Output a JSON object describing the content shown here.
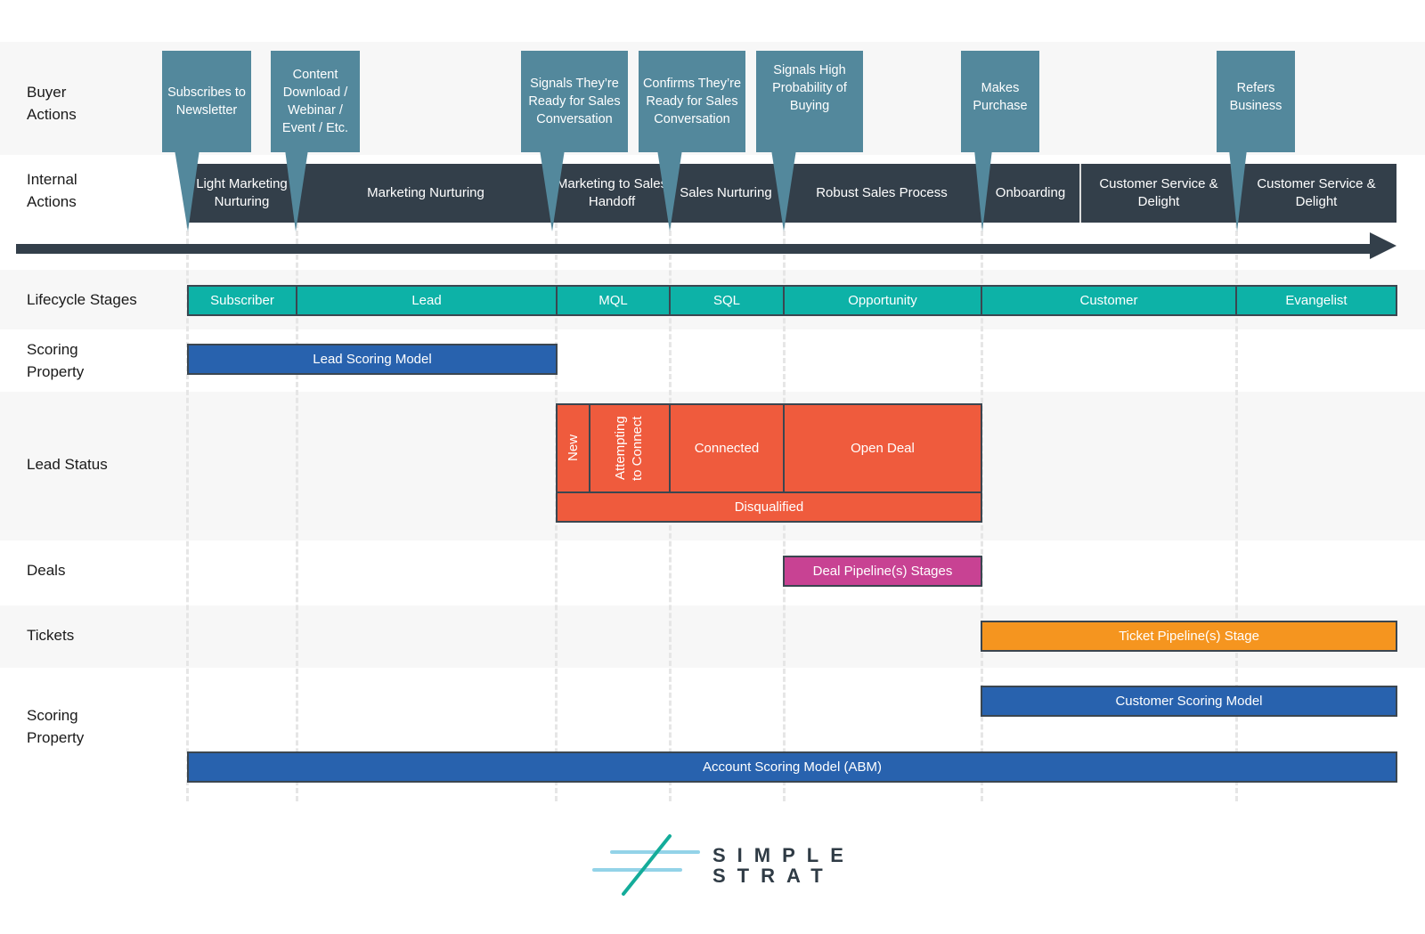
{
  "rows": {
    "buyer_actions": "Buyer\nActions",
    "internal_actions": "Internal\nActions",
    "lifecycle_stages": "Lifecycle Stages",
    "scoring_property_1": "Scoring\nProperty",
    "lead_status": "Lead Status",
    "deals": "Deals",
    "tickets": "Tickets",
    "scoring_property_2": "Scoring\nProperty"
  },
  "buyer_actions": [
    "Subscribes to Newsletter",
    "Content Download / Webinar / Event / Etc.",
    "Signals They’re Ready for Sales Conversation",
    "Confirms They’re Ready for Sales Conversation",
    "Signals High Probability of Buying",
    "Makes Purchase",
    "Refers Business"
  ],
  "internal_actions": [
    "Light Marketing Nurturing",
    "Marketing Nurturing",
    "Marketing to Sales Handoff",
    "Sales Nurturing",
    "Robust Sales Process",
    "Onboarding",
    "Customer Service & Delight",
    "Customer Service & Delight"
  ],
  "lifecycle_stages": [
    "Subscriber",
    "Lead",
    "MQL",
    "SQL",
    "Opportunity",
    "Customer",
    "Evangelist"
  ],
  "scoring": {
    "lead_scoring_model": "Lead Scoring Model",
    "customer_scoring_model": "Customer Scoring Model",
    "account_scoring_model": "Account Scoring Model (ABM)"
  },
  "lead_status": {
    "new": "New",
    "attempting": "Attempting to Connect",
    "connected": "Connected",
    "open_deal": "Open Deal",
    "disqualified": "Disqualified"
  },
  "deals": {
    "label": "Deal Pipeline(s) Stages"
  },
  "tickets": {
    "label": "Ticket Pipeline(s) Stage"
  },
  "logo": {
    "line1": "SIMPLE",
    "line2": "STRAT"
  },
  "colors": {
    "callout": "#53889c",
    "internal": "#333f4a",
    "lifecycle": "#0db2a7",
    "scoring": "#2862ae",
    "lead_status": "#ef5b3d",
    "deals": "#c84293",
    "tickets": "#f5951f"
  }
}
